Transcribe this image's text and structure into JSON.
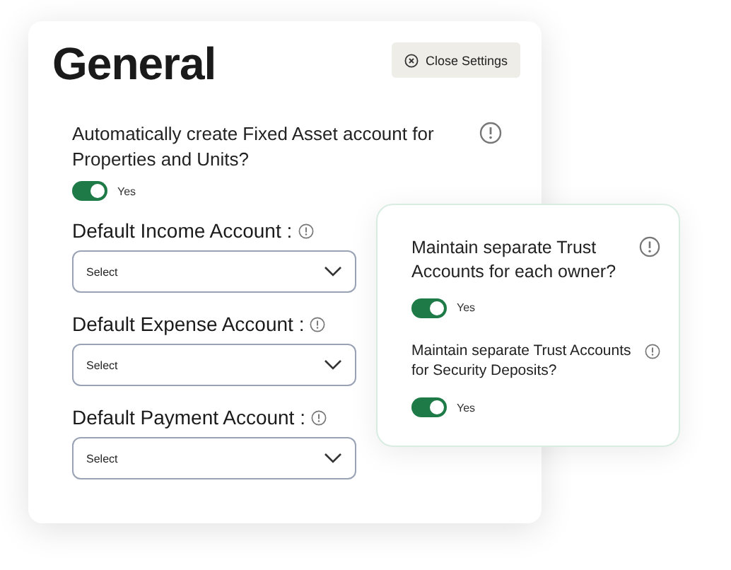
{
  "title": "General",
  "close_button": {
    "label": "Close Settings"
  },
  "fixed_asset": {
    "question": "Automatically create Fixed Asset account for Properties and Units?",
    "on": true,
    "toggle_label": "Yes"
  },
  "accounts": [
    {
      "label": "Default Income Account :",
      "value": "Select"
    },
    {
      "label": "Default Expense Account :",
      "value": "Select"
    },
    {
      "label": "Default Payment Account :",
      "value": "Select"
    }
  ],
  "trust_card": {
    "settings": [
      {
        "question": "Maintain separate Trust Accounts for each owner?",
        "on": true,
        "toggle_label": "Yes"
      },
      {
        "question": "Maintain separate Trust Accounts for Security Deposits?",
        "on": true,
        "toggle_label": "Yes"
      }
    ]
  }
}
